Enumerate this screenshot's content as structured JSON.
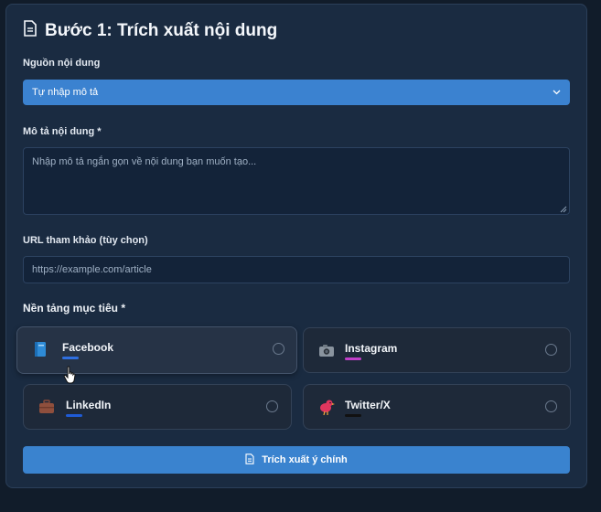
{
  "header": {
    "title": "Bước 1: Trích xuất nội dung",
    "icon": "document-icon"
  },
  "source": {
    "label": "Nguồn nội dung",
    "selected": "Tự nhập mô tả"
  },
  "description": {
    "label": "Mô tả nội dung *",
    "placeholder": "Nhập mô tả ngắn gọn về nội dung bạn muốn tạo..."
  },
  "url": {
    "label": "URL tham khảo (tùy chọn)",
    "placeholder": "https://example.com/article"
  },
  "platforms": {
    "title": "Nền tảng mục tiêu *",
    "items": [
      {
        "name": "Facebook",
        "icon": "book-icon",
        "accent": "#2f6fe0"
      },
      {
        "name": "Instagram",
        "icon": "camera-icon",
        "accent": "#c13fc9"
      },
      {
        "name": "LinkedIn",
        "icon": "briefcase-icon",
        "accent": "#1f5bd6"
      },
      {
        "name": "Twitter/X",
        "icon": "bird-icon",
        "accent": "#111111"
      }
    ]
  },
  "action": {
    "label": "Trích xuất ý chính"
  },
  "colors": {
    "accent": "#3a83cf",
    "panel": "#1a2b41",
    "background": "#111c2a"
  }
}
